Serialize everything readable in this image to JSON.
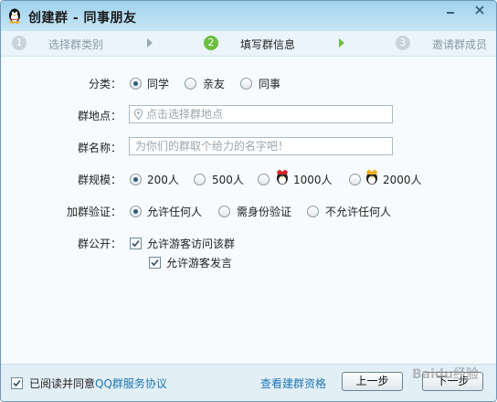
{
  "window": {
    "title": "创建群 - 同事朋友"
  },
  "steps": [
    {
      "num": "1",
      "label": "选择群类别"
    },
    {
      "num": "2",
      "label": "填写群信息"
    },
    {
      "num": "3",
      "label": "邀请群成员"
    }
  ],
  "form": {
    "category": {
      "label": "分类：",
      "options": [
        "同学",
        "亲友",
        "同事"
      ],
      "selected": "同学"
    },
    "location": {
      "label": "群地点：",
      "placeholder": "点击选择群地点"
    },
    "name": {
      "label": "群名称：",
      "placeholder": "为你们的群取个给力的名字吧！"
    },
    "size": {
      "label": "群规模：",
      "options": [
        "200人",
        "500人",
        "1000人",
        "2000人"
      ],
      "selected": "200人"
    },
    "verify": {
      "label": "加群验证：",
      "options": [
        "允许任何人",
        "需身份验证",
        "不允许任何人"
      ],
      "selected": "允许任何人"
    },
    "public": {
      "label": "群公开：",
      "allow_visitor": "允许游客访问该群",
      "allow_speak": "允许游客发言"
    }
  },
  "footer": {
    "agree_prefix": "已阅读并同意",
    "agree_link": "QQ群服务协议",
    "qualification_link": "查看建群资格",
    "prev_label": "上一步",
    "next_label": "下一步"
  },
  "watermark": "Baidu经验",
  "colors": {
    "accent_green": "#6cbf3f",
    "link_blue": "#1f76b5",
    "titlebar": "#9fd2ee"
  }
}
